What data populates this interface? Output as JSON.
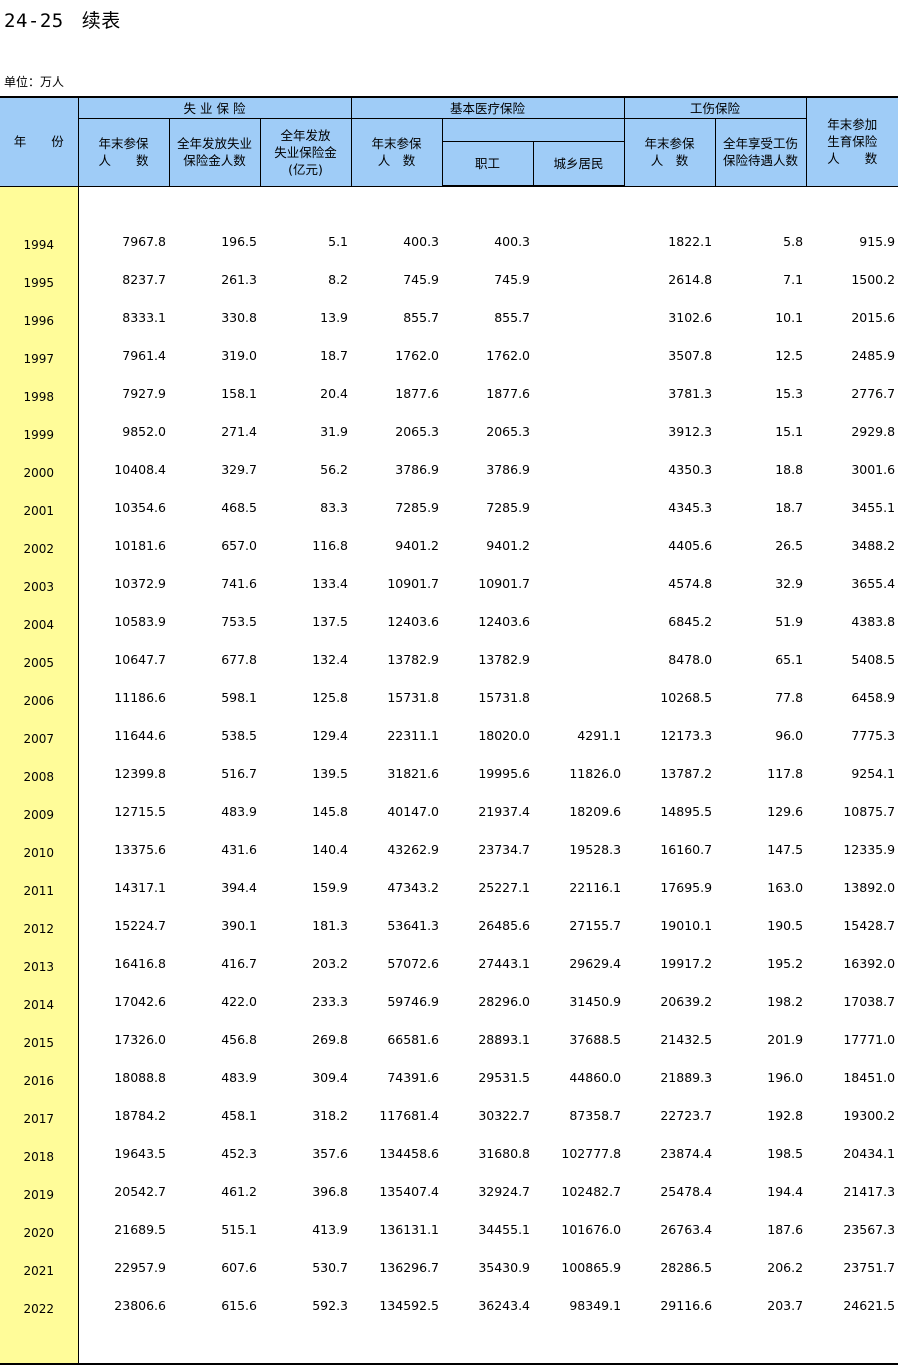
{
  "title": {
    "number": "24-25",
    "name": "续表"
  },
  "unit": "单位：万人",
  "headers": {
    "year": "年　　份",
    "unemployment_group": "失 业 保 险",
    "medical_group": "基本医疗保险",
    "injury_group": "工伤保险",
    "unemp_insured_l1": "年末参保",
    "unemp_insured_l2": "人　　数",
    "unemp_benefit_people_l1": "全年发放失业",
    "unemp_benefit_people_l2": "保险金人数",
    "unemp_benefit_amount_l1": "全年发放",
    "unemp_benefit_amount_l2": "失业保险金",
    "unemp_benefit_amount_l3": "(亿元)",
    "med_insured_l1": "年末参保",
    "med_insured_l2": "人　数",
    "med_staff": "职工",
    "med_residents": "城乡居民",
    "inj_insured_l1": "年末参保",
    "inj_insured_l2": "人　数",
    "inj_benefit_l1": "全年享受工伤",
    "inj_benefit_l2": "保险待遇人数",
    "maternity_l1": "年末参加",
    "maternity_l2": "生育保险",
    "maternity_l3": "人　　数"
  },
  "rows": [
    {
      "year": "1994",
      "c1": "7967.8",
      "c2": "196.5",
      "c3": "5.1",
      "c4": "400.3",
      "c5": "400.3",
      "c6": "",
      "c7": "1822.1",
      "c8": "5.8",
      "c9": "915.9"
    },
    {
      "year": "1995",
      "c1": "8237.7",
      "c2": "261.3",
      "c3": "8.2",
      "c4": "745.9",
      "c5": "745.9",
      "c6": "",
      "c7": "2614.8",
      "c8": "7.1",
      "c9": "1500.2"
    },
    {
      "year": "1996",
      "c1": "8333.1",
      "c2": "330.8",
      "c3": "13.9",
      "c4": "855.7",
      "c5": "855.7",
      "c6": "",
      "c7": "3102.6",
      "c8": "10.1",
      "c9": "2015.6"
    },
    {
      "year": "1997",
      "c1": "7961.4",
      "c2": "319.0",
      "c3": "18.7",
      "c4": "1762.0",
      "c5": "1762.0",
      "c6": "",
      "c7": "3507.8",
      "c8": "12.5",
      "c9": "2485.9"
    },
    {
      "year": "1998",
      "c1": "7927.9",
      "c2": "158.1",
      "c3": "20.4",
      "c4": "1877.6",
      "c5": "1877.6",
      "c6": "",
      "c7": "3781.3",
      "c8": "15.3",
      "c9": "2776.7"
    },
    {
      "year": "1999",
      "c1": "9852.0",
      "c2": "271.4",
      "c3": "31.9",
      "c4": "2065.3",
      "c5": "2065.3",
      "c6": "",
      "c7": "3912.3",
      "c8": "15.1",
      "c9": "2929.8"
    },
    {
      "year": "2000",
      "c1": "10408.4",
      "c2": "329.7",
      "c3": "56.2",
      "c4": "3786.9",
      "c5": "3786.9",
      "c6": "",
      "c7": "4350.3",
      "c8": "18.8",
      "c9": "3001.6"
    },
    {
      "year": "2001",
      "c1": "10354.6",
      "c2": "468.5",
      "c3": "83.3",
      "c4": "7285.9",
      "c5": "7285.9",
      "c6": "",
      "c7": "4345.3",
      "c8": "18.7",
      "c9": "3455.1"
    },
    {
      "year": "2002",
      "c1": "10181.6",
      "c2": "657.0",
      "c3": "116.8",
      "c4": "9401.2",
      "c5": "9401.2",
      "c6": "",
      "c7": "4405.6",
      "c8": "26.5",
      "c9": "3488.2"
    },
    {
      "year": "2003",
      "c1": "10372.9",
      "c2": "741.6",
      "c3": "133.4",
      "c4": "10901.7",
      "c5": "10901.7",
      "c6": "",
      "c7": "4574.8",
      "c8": "32.9",
      "c9": "3655.4"
    },
    {
      "year": "2004",
      "c1": "10583.9",
      "c2": "753.5",
      "c3": "137.5",
      "c4": "12403.6",
      "c5": "12403.6",
      "c6": "",
      "c7": "6845.2",
      "c8": "51.9",
      "c9": "4383.8"
    },
    {
      "year": "2005",
      "c1": "10647.7",
      "c2": "677.8",
      "c3": "132.4",
      "c4": "13782.9",
      "c5": "13782.9",
      "c6": "",
      "c7": "8478.0",
      "c8": "65.1",
      "c9": "5408.5"
    },
    {
      "year": "2006",
      "c1": "11186.6",
      "c2": "598.1",
      "c3": "125.8",
      "c4": "15731.8",
      "c5": "15731.8",
      "c6": "",
      "c7": "10268.5",
      "c8": "77.8",
      "c9": "6458.9"
    },
    {
      "year": "2007",
      "c1": "11644.6",
      "c2": "538.5",
      "c3": "129.4",
      "c4": "22311.1",
      "c5": "18020.0",
      "c6": "4291.1",
      "c7": "12173.3",
      "c8": "96.0",
      "c9": "7775.3"
    },
    {
      "year": "2008",
      "c1": "12399.8",
      "c2": "516.7",
      "c3": "139.5",
      "c4": "31821.6",
      "c5": "19995.6",
      "c6": "11826.0",
      "c7": "13787.2",
      "c8": "117.8",
      "c9": "9254.1"
    },
    {
      "year": "2009",
      "c1": "12715.5",
      "c2": "483.9",
      "c3": "145.8",
      "c4": "40147.0",
      "c5": "21937.4",
      "c6": "18209.6",
      "c7": "14895.5",
      "c8": "129.6",
      "c9": "10875.7"
    },
    {
      "year": "2010",
      "c1": "13375.6",
      "c2": "431.6",
      "c3": "140.4",
      "c4": "43262.9",
      "c5": "23734.7",
      "c6": "19528.3",
      "c7": "16160.7",
      "c8": "147.5",
      "c9": "12335.9"
    },
    {
      "year": "2011",
      "c1": "14317.1",
      "c2": "394.4",
      "c3": "159.9",
      "c4": "47343.2",
      "c5": "25227.1",
      "c6": "22116.1",
      "c7": "17695.9",
      "c8": "163.0",
      "c9": "13892.0"
    },
    {
      "year": "2012",
      "c1": "15224.7",
      "c2": "390.1",
      "c3": "181.3",
      "c4": "53641.3",
      "c5": "26485.6",
      "c6": "27155.7",
      "c7": "19010.1",
      "c8": "190.5",
      "c9": "15428.7"
    },
    {
      "year": "2013",
      "c1": "16416.8",
      "c2": "416.7",
      "c3": "203.2",
      "c4": "57072.6",
      "c5": "27443.1",
      "c6": "29629.4",
      "c7": "19917.2",
      "c8": "195.2",
      "c9": "16392.0"
    },
    {
      "year": "2014",
      "c1": "17042.6",
      "c2": "422.0",
      "c3": "233.3",
      "c4": "59746.9",
      "c5": "28296.0",
      "c6": "31450.9",
      "c7": "20639.2",
      "c8": "198.2",
      "c9": "17038.7"
    },
    {
      "year": "2015",
      "c1": "17326.0",
      "c2": "456.8",
      "c3": "269.8",
      "c4": "66581.6",
      "c5": "28893.1",
      "c6": "37688.5",
      "c7": "21432.5",
      "c8": "201.9",
      "c9": "17771.0"
    },
    {
      "year": "2016",
      "c1": "18088.8",
      "c2": "483.9",
      "c3": "309.4",
      "c4": "74391.6",
      "c5": "29531.5",
      "c6": "44860.0",
      "c7": "21889.3",
      "c8": "196.0",
      "c9": "18451.0"
    },
    {
      "year": "2017",
      "c1": "18784.2",
      "c2": "458.1",
      "c3": "318.2",
      "c4": "117681.4",
      "c5": "30322.7",
      "c6": "87358.7",
      "c7": "22723.7",
      "c8": "192.8",
      "c9": "19300.2"
    },
    {
      "year": "2018",
      "c1": "19643.5",
      "c2": "452.3",
      "c3": "357.6",
      "c4": "134458.6",
      "c5": "31680.8",
      "c6": "102777.8",
      "c7": "23874.4",
      "c8": "198.5",
      "c9": "20434.1"
    },
    {
      "year": "2019",
      "c1": "20542.7",
      "c2": "461.2",
      "c3": "396.8",
      "c4": "135407.4",
      "c5": "32924.7",
      "c6": "102482.7",
      "c7": "25478.4",
      "c8": "194.4",
      "c9": "21417.3"
    },
    {
      "year": "2020",
      "c1": "21689.5",
      "c2": "515.1",
      "c3": "413.9",
      "c4": "136131.1",
      "c5": "34455.1",
      "c6": "101676.0",
      "c7": "26763.4",
      "c8": "187.6",
      "c9": "23567.3"
    },
    {
      "year": "2021",
      "c1": "22957.9",
      "c2": "607.6",
      "c3": "530.7",
      "c4": "136296.7",
      "c5": "35430.9",
      "c6": "100865.9",
      "c7": "28286.5",
      "c8": "206.2",
      "c9": "23751.7"
    },
    {
      "year": "2022",
      "c1": "23806.6",
      "c2": "615.6",
      "c3": "592.3",
      "c4": "134592.5",
      "c5": "36243.4",
      "c6": "98349.1",
      "c7": "29116.6",
      "c8": "203.7",
      "c9": "24621.5"
    }
  ]
}
